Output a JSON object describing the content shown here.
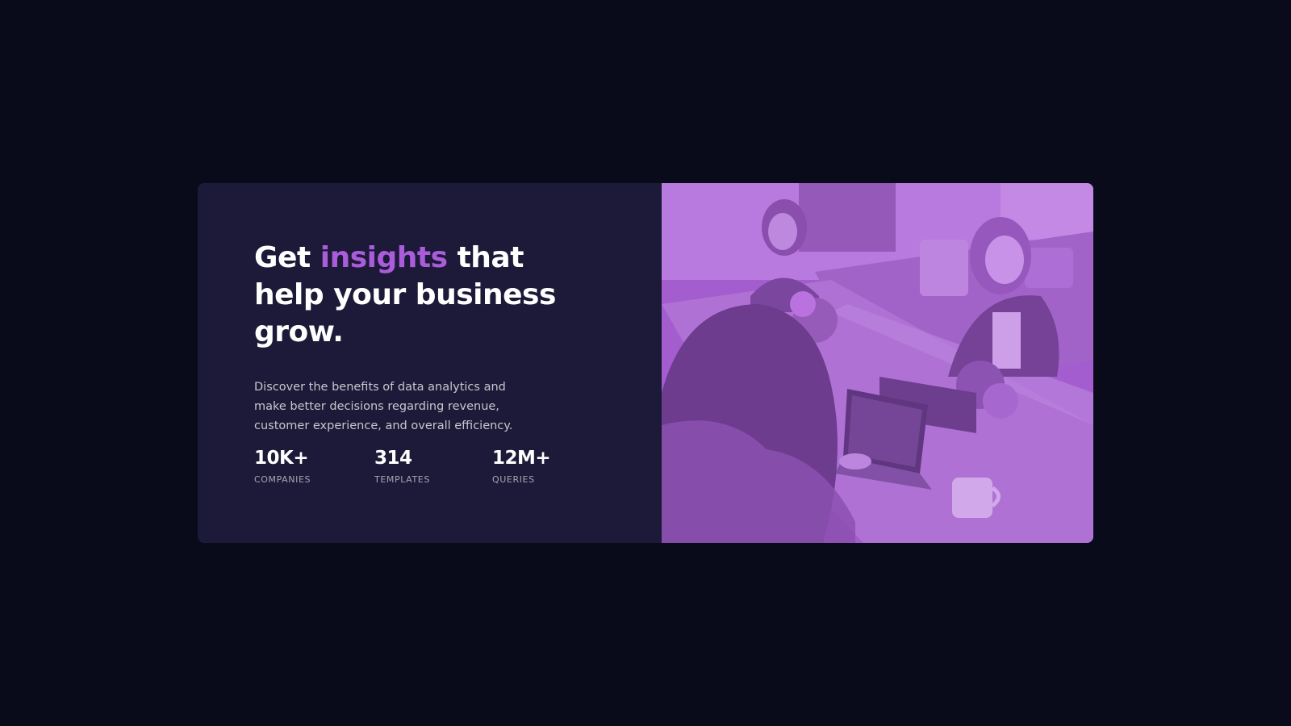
{
  "hero": {
    "headline_before": "Get",
    "headline_accent": "insights",
    "headline_after": "that help your business grow.",
    "description": "Discover the benefits of data analytics and make better decisions regarding revenue, customer experience, and overall efficiency.",
    "accent_color": "#aa5cdb",
    "image_alt": "Three women working together at a table with laptops",
    "image_tint_color": "#aa5cdb"
  },
  "stats": [
    {
      "value": "10K+",
      "label": "COMPANIES"
    },
    {
      "value": "314",
      "label": "TEMPLATES"
    },
    {
      "value": "12M+",
      "label": "QUERIES"
    }
  ]
}
